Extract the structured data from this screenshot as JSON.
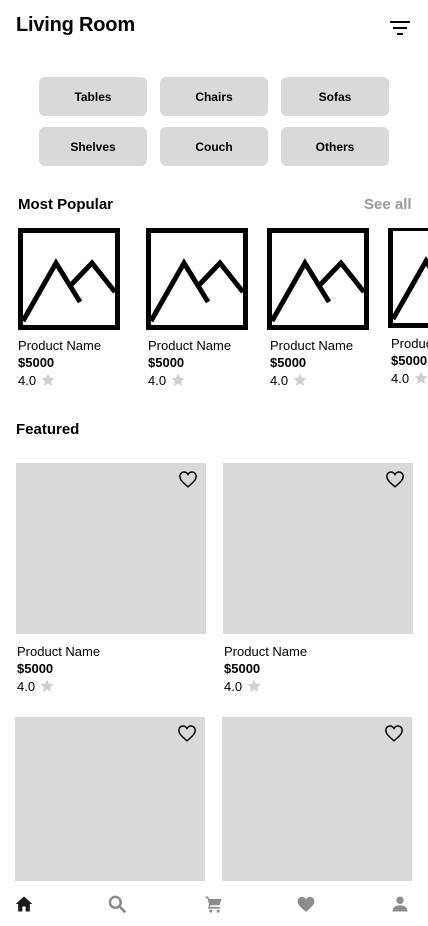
{
  "header": {
    "title": "Living Room",
    "filter_icon": "filter-icon"
  },
  "categories": [
    "Tables",
    "Chairs",
    "Sofas",
    "Shelves",
    "Couch",
    "Others"
  ],
  "popular": {
    "title": "Most Popular",
    "see_all": "See all",
    "items": [
      {
        "name": "Product Name",
        "price": "$5000",
        "rating": "4.0"
      },
      {
        "name": "Product Name",
        "price": "$5000",
        "rating": "4.0"
      },
      {
        "name": "Product Name",
        "price": "$5000",
        "rating": "4.0"
      },
      {
        "name": "Product Name",
        "price": "$5000",
        "rating": "4.0"
      }
    ]
  },
  "featured": {
    "title": "Featured",
    "items": [
      {
        "name": "Product Name",
        "price": "$5000",
        "rating": "4.0"
      },
      {
        "name": "Product Name",
        "price": "$5000",
        "rating": "4.0"
      },
      {
        "name": "",
        "price": "",
        "rating": ""
      },
      {
        "name": "",
        "price": "",
        "rating": ""
      }
    ]
  },
  "bottom_nav": {
    "items": [
      "home-icon",
      "search-icon",
      "cart-icon",
      "heart-icon",
      "user-icon"
    ],
    "active": "home-icon",
    "active_color": "#1a1a1a",
    "inactive_color": "#8c8c8c"
  },
  "colors": {
    "chip_bg": "#d9d9d9",
    "placeholder_bg": "#d9d9d9",
    "see_all": "#9a9a9a",
    "star": "#cfcfcf"
  }
}
